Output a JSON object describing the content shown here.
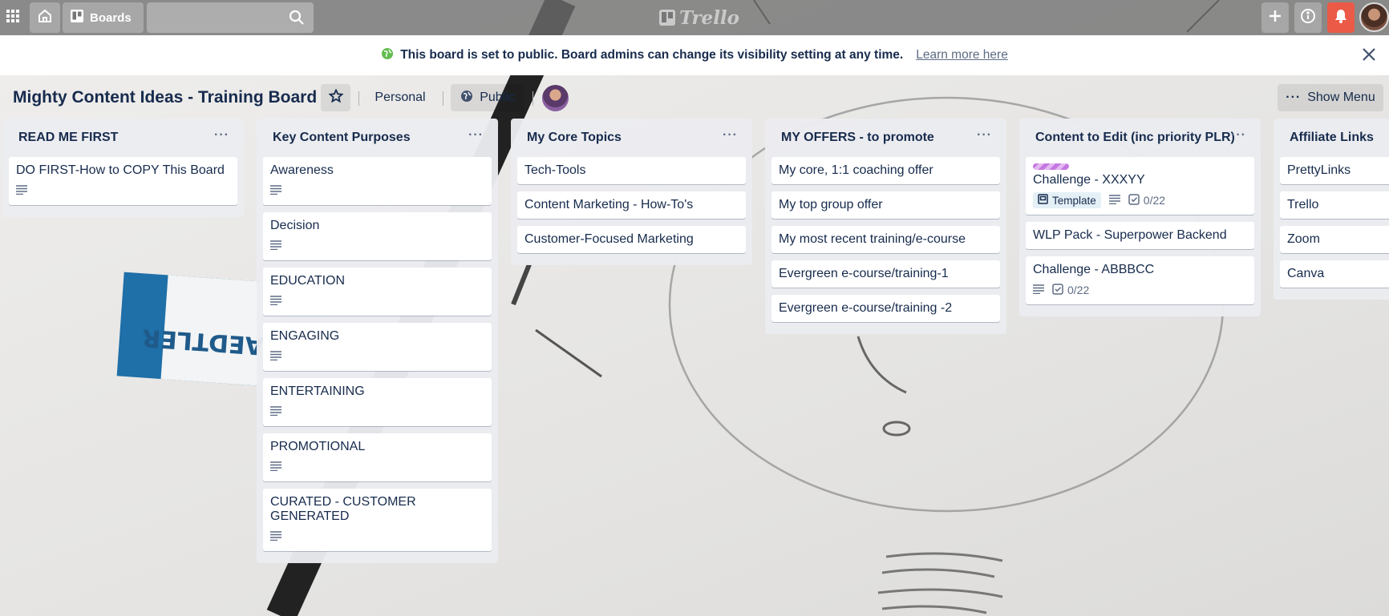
{
  "header": {
    "boards_label": "Boards",
    "search_value": "",
    "logo_text": "Trello"
  },
  "banner": {
    "message": "This board is set to public. Board admins can change its visibility setting at any time.",
    "link": "Learn more here"
  },
  "board": {
    "title": "Mighty Content Ideas - Training Board",
    "team": "Personal",
    "visibility": "Public",
    "show_menu": "Show Menu"
  },
  "lists": [
    {
      "title": "READ ME FIRST",
      "cards": [
        {
          "title": "DO FIRST-How to COPY This Board",
          "has_description": true
        }
      ]
    },
    {
      "title": "Key Content Purposes",
      "cards": [
        {
          "title": "Awareness",
          "has_description": true
        },
        {
          "title": "Decision",
          "has_description": true
        },
        {
          "title": "EDUCATION",
          "has_description": true
        },
        {
          "title": "ENGAGING",
          "has_description": true
        },
        {
          "title": "ENTERTAINING",
          "has_description": true
        },
        {
          "title": "PROMOTIONAL",
          "has_description": true
        },
        {
          "title": "CURATED - CUSTOMER GENERATED",
          "has_description": true
        }
      ]
    },
    {
      "title": "My Core Topics",
      "cards": [
        {
          "title": "Tech-Tools"
        },
        {
          "title": "Content Marketing - How-To's"
        },
        {
          "title": "Customer-Focused Marketing"
        }
      ]
    },
    {
      "title": "MY OFFERS - to promote",
      "cards": [
        {
          "title": "My core, 1:1 coaching offer"
        },
        {
          "title": "My top group offer"
        },
        {
          "title": "My most recent training/e-course"
        },
        {
          "title": "Evergreen e-course/training-1"
        },
        {
          "title": "Evergreen e-course/training -2"
        }
      ]
    },
    {
      "title": "Content to Edit (inc priority PLR)",
      "cards": [
        {
          "title": "Challenge - XXXYY",
          "label_color": "#c377e0",
          "template": "Template",
          "has_description": true,
          "checklist": "0/22"
        },
        {
          "title": "WLP Pack - Superpower Backend"
        },
        {
          "title": "Challenge - ABBBCC",
          "has_description": true,
          "checklist": "0/22"
        }
      ]
    },
    {
      "title": "Affiliate Links",
      "cards": [
        {
          "title": "PrettyLinks"
        },
        {
          "title": "Trello"
        },
        {
          "title": "Zoom"
        },
        {
          "title": "Canva"
        }
      ]
    }
  ],
  "colors": {
    "banner_icon": "#61bd4f",
    "notification": "#eb5a46",
    "label_purple": "#c377e0"
  },
  "icons": {
    "apps": "grid-icon",
    "home": "home-icon",
    "boards": "boards-icon",
    "search": "search-icon",
    "add": "plus-icon",
    "info": "info-icon",
    "notifications": "bell-icon",
    "close": "close-icon",
    "star": "star-icon",
    "public": "globe-icon",
    "menu": "more-icon",
    "description": "description-icon",
    "checklist": "checklist-icon",
    "template": "template-icon"
  }
}
